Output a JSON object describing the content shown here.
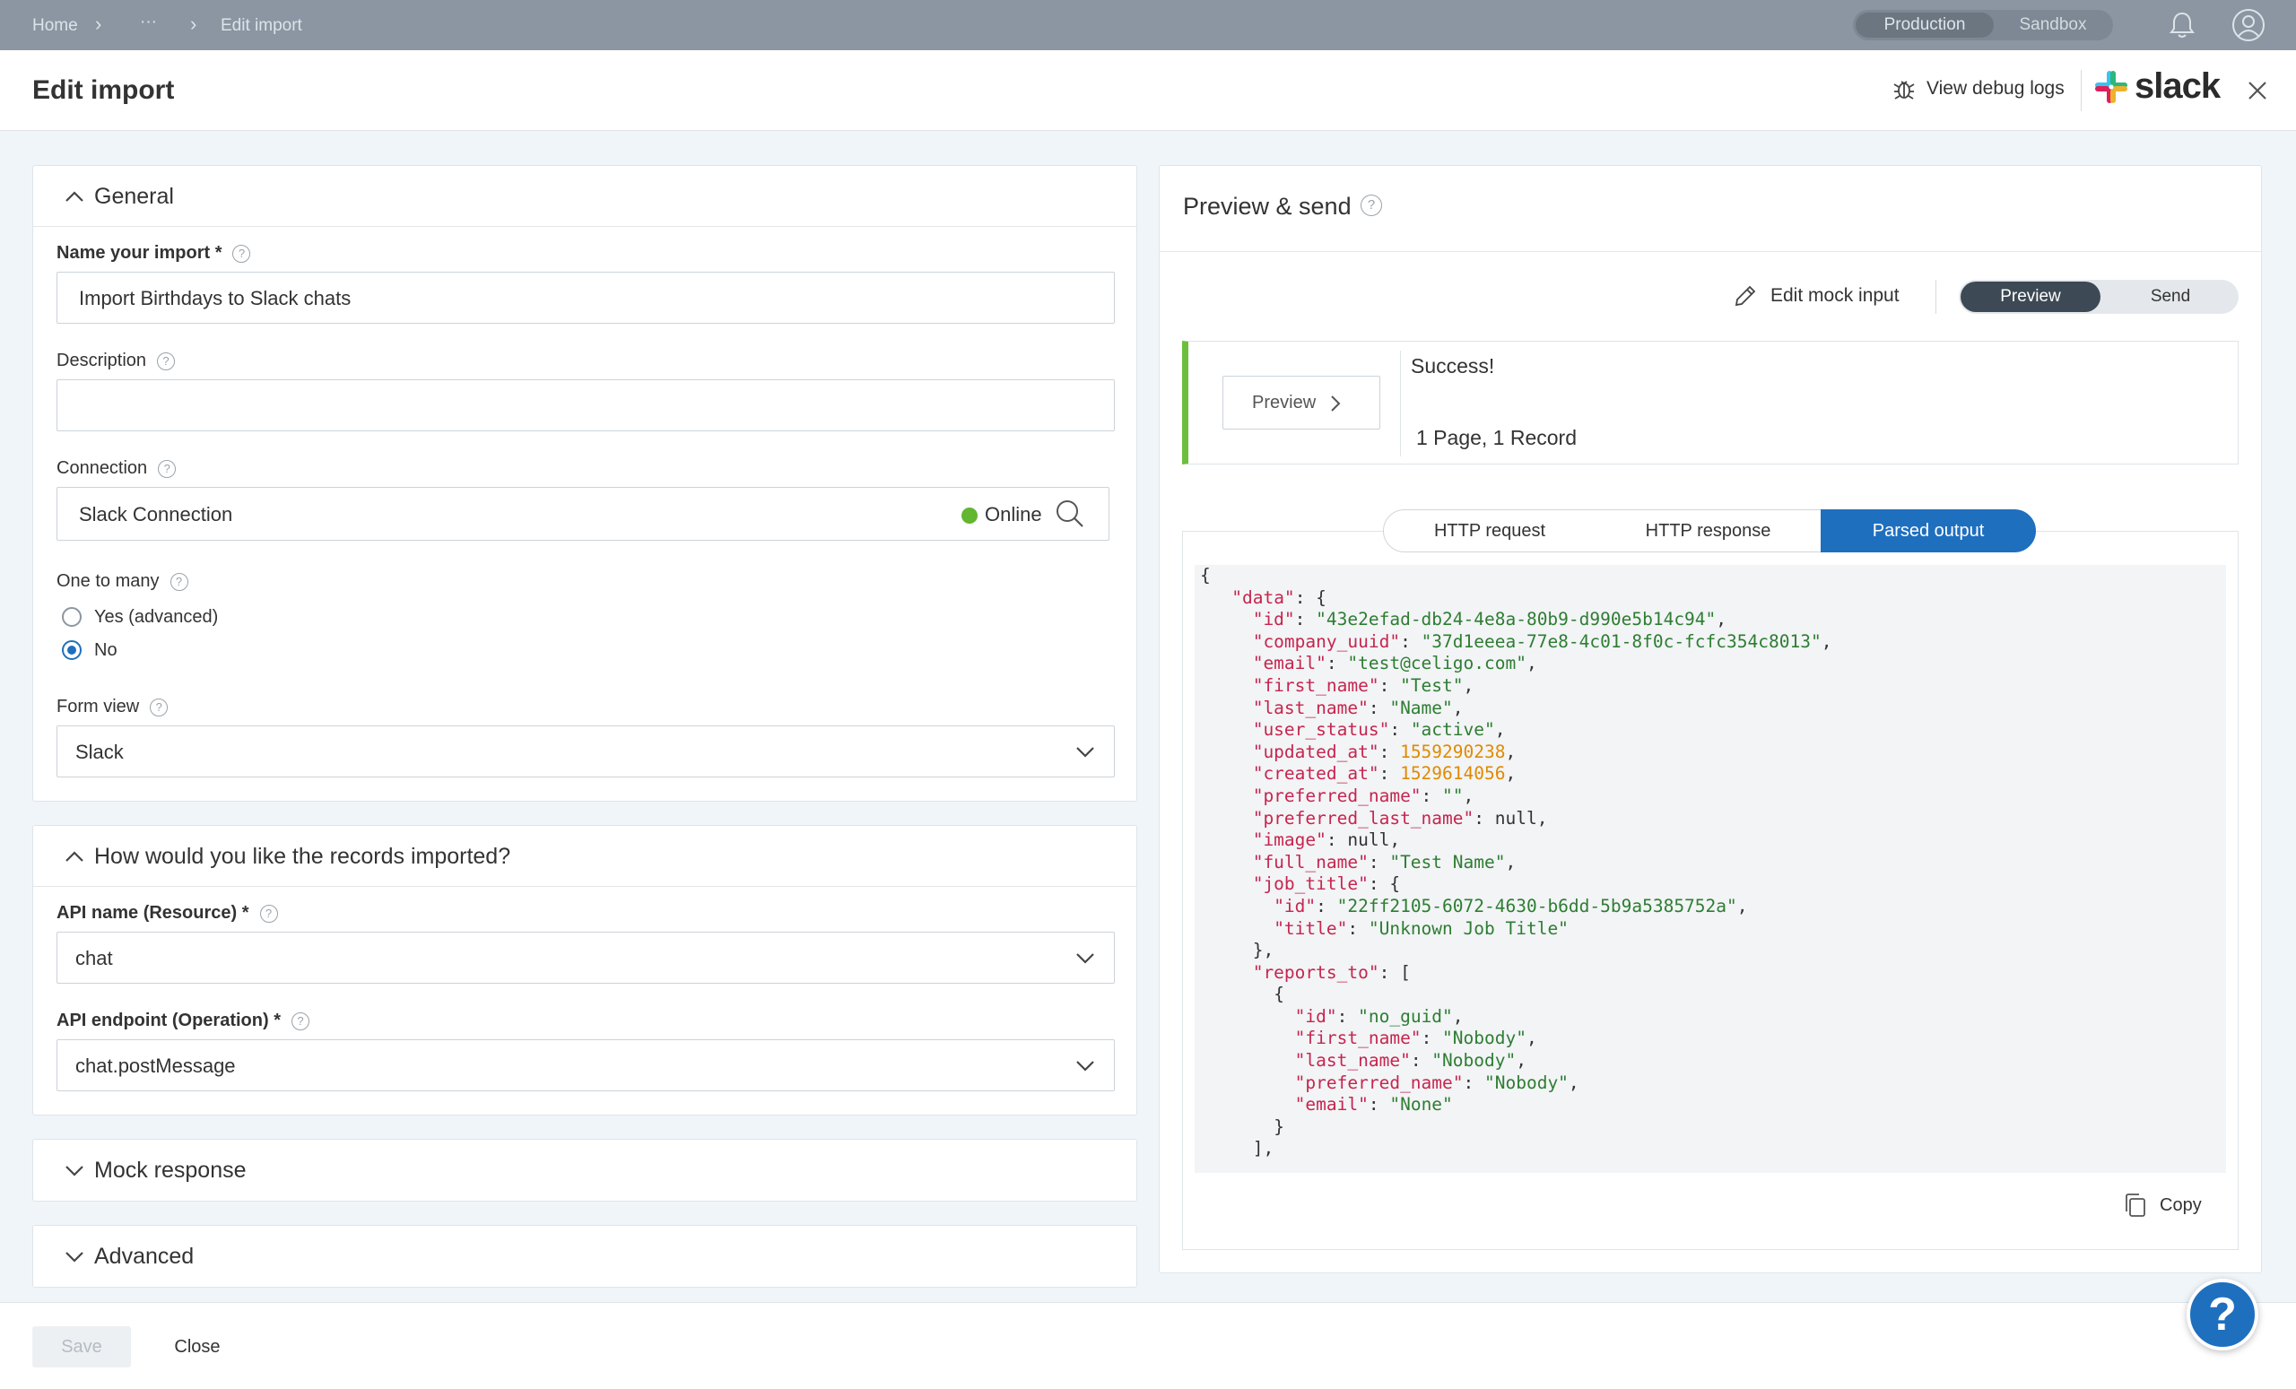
{
  "breadcrumb": {
    "home": "Home",
    "more": "···",
    "current": "Edit import"
  },
  "env": {
    "production": "Production",
    "sandbox": "Sandbox"
  },
  "header": {
    "title": "Edit import",
    "debug_logs": "View debug logs",
    "brand": "slack"
  },
  "general": {
    "title": "General",
    "name_label": "Name your import *",
    "name_value": "Import Birthdays to Slack chats",
    "description_label": "Description",
    "description_value": "",
    "connection_label": "Connection",
    "connection_value": "Slack Connection",
    "connection_status": "Online",
    "one_to_many_label": "One to many",
    "option_yes": "Yes (advanced)",
    "option_no": "No",
    "form_view_label": "Form view",
    "form_view_value": "Slack"
  },
  "records": {
    "title": "How would you like the records imported?",
    "api_name_label": "API name (Resource) *",
    "api_name_value": "chat",
    "api_endpoint_label": "API endpoint (Operation) *",
    "api_endpoint_value": "chat.postMessage"
  },
  "sections": {
    "mock_response": "Mock response",
    "advanced": "Advanced"
  },
  "preview": {
    "title": "Preview & send",
    "edit_mock": "Edit mock input",
    "mode_preview": "Preview",
    "mode_send": "Send",
    "preview_button": "Preview",
    "status": "Success!",
    "summary": "1 Page, 1 Record",
    "tabs": [
      "HTTP request",
      "HTTP response",
      "Parsed output"
    ],
    "active_tab": "Parsed output",
    "copy": "Copy"
  },
  "json_lines": [
    {
      "i": 0,
      "t": [
        [
          "p",
          "{"
        ]
      ]
    },
    {
      "i": 1,
      "t": [
        [
          "k",
          "\"data\""
        ],
        [
          "p",
          ": {"
        ]
      ]
    },
    {
      "i": 2,
      "t": [
        [
          "k",
          "\"id\""
        ],
        [
          "p",
          ": "
        ],
        [
          "s",
          "\"43e2efad-db24-4e8a-80b9-d990e5b14c94\""
        ],
        [
          "p",
          ","
        ]
      ]
    },
    {
      "i": 2,
      "t": [
        [
          "k",
          "\"company_uuid\""
        ],
        [
          "p",
          ": "
        ],
        [
          "s",
          "\"37d1eeea-77e8-4c01-8f0c-fcfc354c8013\""
        ],
        [
          "p",
          ","
        ]
      ]
    },
    {
      "i": 2,
      "t": [
        [
          "k",
          "\"email\""
        ],
        [
          "p",
          ": "
        ],
        [
          "s",
          "\"test@celigo.com\""
        ],
        [
          "p",
          ","
        ]
      ]
    },
    {
      "i": 2,
      "t": [
        [
          "k",
          "\"first_name\""
        ],
        [
          "p",
          ": "
        ],
        [
          "s",
          "\"Test\""
        ],
        [
          "p",
          ","
        ]
      ]
    },
    {
      "i": 2,
      "t": [
        [
          "k",
          "\"last_name\""
        ],
        [
          "p",
          ": "
        ],
        [
          "s",
          "\"Name\""
        ],
        [
          "p",
          ","
        ]
      ]
    },
    {
      "i": 2,
      "t": [
        [
          "k",
          "\"user_status\""
        ],
        [
          "p",
          ": "
        ],
        [
          "s",
          "\"active\""
        ],
        [
          "p",
          ","
        ]
      ]
    },
    {
      "i": 2,
      "t": [
        [
          "k",
          "\"updated_at\""
        ],
        [
          "p",
          ": "
        ],
        [
          "n",
          "1559290238"
        ],
        [
          "p",
          ","
        ]
      ]
    },
    {
      "i": 2,
      "t": [
        [
          "k",
          "\"created_at\""
        ],
        [
          "p",
          ": "
        ],
        [
          "n",
          "1529614056"
        ],
        [
          "p",
          ","
        ]
      ]
    },
    {
      "i": 2,
      "t": [
        [
          "k",
          "\"preferred_name\""
        ],
        [
          "p",
          ": "
        ],
        [
          "s",
          "\"\""
        ],
        [
          "p",
          ","
        ]
      ]
    },
    {
      "i": 2,
      "t": [
        [
          "k",
          "\"preferred_last_name\""
        ],
        [
          "p",
          ": null,"
        ]
      ]
    },
    {
      "i": 2,
      "t": [
        [
          "k",
          "\"image\""
        ],
        [
          "p",
          ": null,"
        ]
      ]
    },
    {
      "i": 2,
      "t": [
        [
          "k",
          "\"full_name\""
        ],
        [
          "p",
          ": "
        ],
        [
          "s",
          "\"Test Name\""
        ],
        [
          "p",
          ","
        ]
      ]
    },
    {
      "i": 2,
      "t": [
        [
          "k",
          "\"job_title\""
        ],
        [
          "p",
          ": {"
        ]
      ]
    },
    {
      "i": 3,
      "t": [
        [
          "k",
          "\"id\""
        ],
        [
          "p",
          ": "
        ],
        [
          "s",
          "\"22ff2105-6072-4630-b6dd-5b9a5385752a\""
        ],
        [
          "p",
          ","
        ]
      ]
    },
    {
      "i": 3,
      "t": [
        [
          "k",
          "\"title\""
        ],
        [
          "p",
          ": "
        ],
        [
          "s",
          "\"Unknown Job Title\""
        ]
      ]
    },
    {
      "i": 2,
      "t": [
        [
          "p",
          "},"
        ]
      ]
    },
    {
      "i": 2,
      "t": [
        [
          "k",
          "\"reports_to\""
        ],
        [
          "p",
          ": ["
        ]
      ]
    },
    {
      "i": 3,
      "t": [
        [
          "p",
          "{"
        ]
      ]
    },
    {
      "i": 4,
      "t": [
        [
          "k",
          "\"id\""
        ],
        [
          "p",
          ": "
        ],
        [
          "s",
          "\"no_guid\""
        ],
        [
          "p",
          ","
        ]
      ]
    },
    {
      "i": 4,
      "t": [
        [
          "k",
          "\"first_name\""
        ],
        [
          "p",
          ": "
        ],
        [
          "s",
          "\"Nobody\""
        ],
        [
          "p",
          ","
        ]
      ]
    },
    {
      "i": 4,
      "t": [
        [
          "k",
          "\"last_name\""
        ],
        [
          "p",
          ": "
        ],
        [
          "s",
          "\"Nobody\""
        ],
        [
          "p",
          ","
        ]
      ]
    },
    {
      "i": 4,
      "t": [
        [
          "k",
          "\"preferred_name\""
        ],
        [
          "p",
          ": "
        ],
        [
          "s",
          "\"Nobody\""
        ],
        [
          "p",
          ","
        ]
      ]
    },
    {
      "i": 4,
      "t": [
        [
          "k",
          "\"email\""
        ],
        [
          "p",
          ": "
        ],
        [
          "s",
          "\"None\""
        ]
      ]
    },
    {
      "i": 3,
      "t": [
        [
          "p",
          "}"
        ]
      ]
    },
    {
      "i": 2,
      "t": [
        [
          "p",
          "],"
        ]
      ]
    }
  ],
  "footer": {
    "save": "Save",
    "close": "Close",
    "help": "?"
  },
  "colors": {
    "accent": "#1f6fbf",
    "success": "#6cbf3e",
    "online": "#62b630"
  },
  "icons": [
    "chevron-right-icon",
    "more-icon",
    "bell-icon",
    "user-icon",
    "bug-icon",
    "slack-logo-icon",
    "close-icon",
    "chevron-up-icon",
    "chevron-down-icon",
    "help-icon",
    "search-icon",
    "pencil-icon",
    "copy-icon"
  ]
}
